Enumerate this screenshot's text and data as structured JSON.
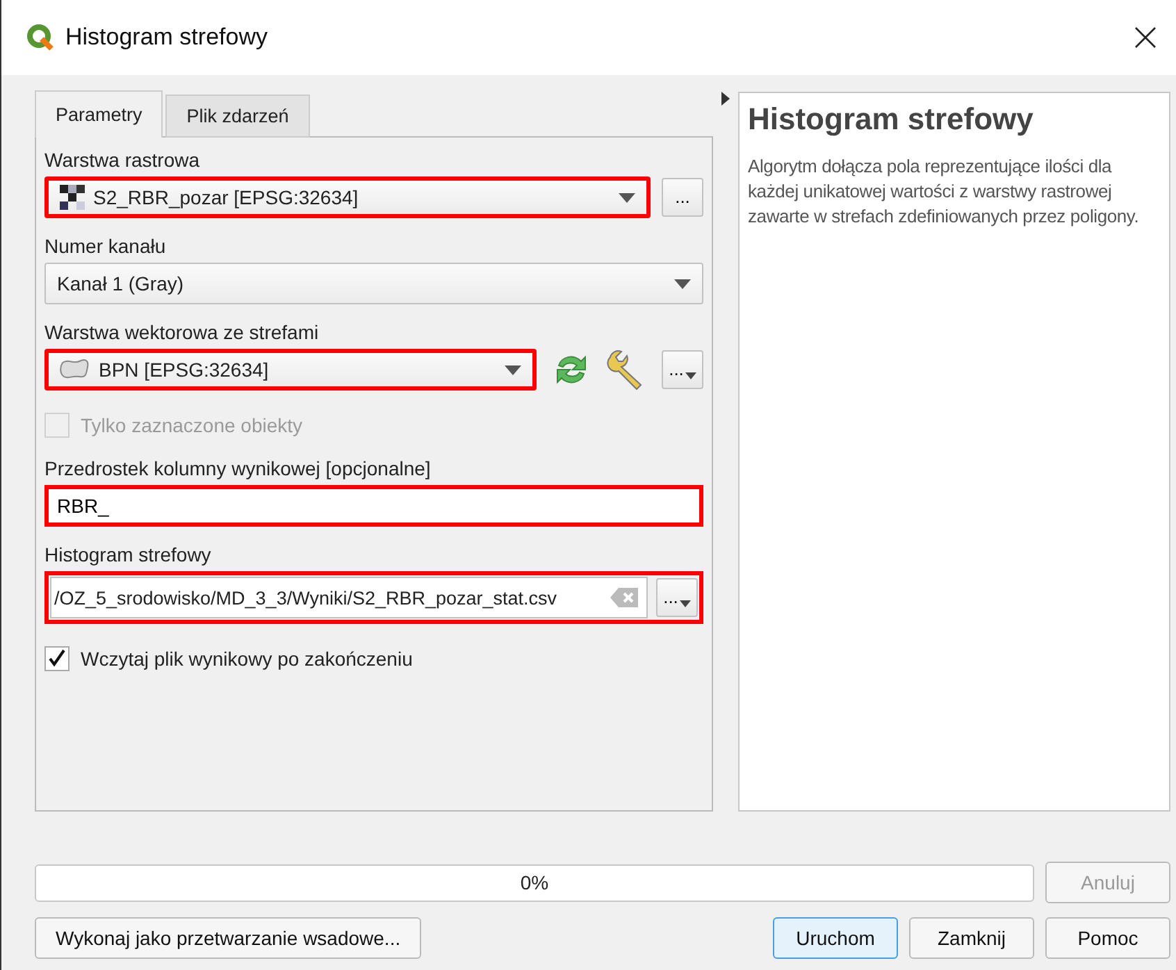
{
  "window": {
    "title": "Histogram strefowy"
  },
  "tabs": [
    {
      "label": "Parametry",
      "selected": true
    },
    {
      "label": "Plik zdarzeń",
      "selected": false
    }
  ],
  "parameters": [
    {
      "kind": "raster",
      "label": "Warstwa rastrowa",
      "value": "S2_RBR_pozar [EPSG:32634]",
      "highlighted": true,
      "more": "..."
    },
    {
      "kind": "band",
      "label": "Numer kanału",
      "value": "Kanał 1 (Gray)",
      "highlighted": false
    },
    {
      "kind": "vector",
      "label": "Warstwa wektorowa ze strefami",
      "value": "BPN [EPSG:32634]",
      "highlighted": true,
      "more": "..."
    },
    {
      "kind": "checkbox",
      "label": "Tylko zaznaczone obiekty",
      "checked": false,
      "disabled": true
    },
    {
      "kind": "text",
      "label": "Przedrostek kolumny wynikowej [opcjonalne]",
      "value": "RBR_",
      "highlighted": true
    },
    {
      "kind": "file",
      "label": "Histogram strefowy",
      "value": "/OZ_5_srodowisko/MD_3_3/Wyniki/S2_RBR_pozar_stat.csv",
      "highlighted": true,
      "more": "..."
    },
    {
      "kind": "checkbox",
      "label": "Wczytaj plik wynikowy po zakończeniu",
      "checked": true,
      "disabled": false
    }
  ],
  "help": {
    "title": "Histogram strefowy",
    "text": "Algorytm dołącza pola reprezentujące ilości dla każdej unikatowej wartości z warstwy rastrowej zawarte w strefach zdefiniowanych przez poligony."
  },
  "progress": {
    "level": 0,
    "reading": "0%"
  },
  "cancel_button": {
    "label": "Anuluj",
    "disabled": true
  },
  "batch_button": "Wykonaj jako przetwarzanie wsadowe...",
  "buttons": [
    {
      "label": "Uruchom",
      "selected": true
    },
    {
      "label": "Zamknij",
      "selected": false
    },
    {
      "label": "Pomoc",
      "selected": false
    }
  ]
}
